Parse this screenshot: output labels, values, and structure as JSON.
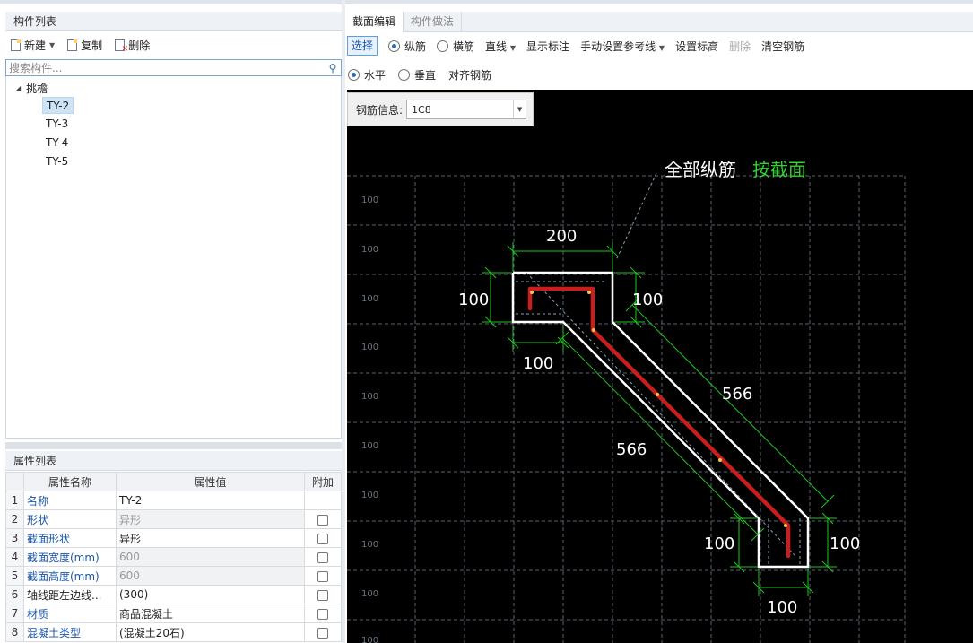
{
  "left_panel": {
    "title": "构件列表",
    "toolbar": {
      "new_label": "新建",
      "copy_label": "复制",
      "delete_label": "删除"
    },
    "search_placeholder": "搜索构件...",
    "tree": {
      "root_label": "挑檐",
      "items": [
        "TY-2",
        "TY-3",
        "TY-4",
        "TY-5"
      ],
      "selected": "TY-2"
    }
  },
  "properties": {
    "title": "属性列表",
    "headers": [
      "属性名称",
      "属性值",
      "附加"
    ],
    "rows": [
      {
        "idx": "1",
        "name": "名称",
        "value": "TY-2"
      },
      {
        "idx": "2",
        "name": "形状",
        "value": "异形"
      },
      {
        "idx": "3",
        "name": "截面形状",
        "value": "异形"
      },
      {
        "idx": "4",
        "name": "截面宽度(mm)",
        "value": "600"
      },
      {
        "idx": "5",
        "name": "截面高度(mm)",
        "value": "600"
      },
      {
        "idx": "6",
        "name": "轴线距左边线...",
        "value": "(300)"
      },
      {
        "idx": "7",
        "name": "材质",
        "value": "商品混凝土"
      },
      {
        "idx": "8",
        "name": "混凝土类型",
        "value": "(混凝土20石)"
      }
    ]
  },
  "editor": {
    "tabs": [
      "截面编辑",
      "构件做法"
    ],
    "toolbar1": {
      "select": "选择",
      "longitudinal": "纵筋",
      "transverse": "横筋",
      "line": "直线",
      "show_dims": "显示标注",
      "manual_ref": "手动设置参考线",
      "set_elevation": "设置标高",
      "delete": "删除",
      "clear_rebar": "清空钢筋"
    },
    "toolbar2": {
      "horizontal": "水平",
      "vertical": "垂直",
      "align_rebar": "对齐钢筋"
    },
    "rebar_info": {
      "label": "钢筋信息:",
      "value": "1C8"
    },
    "canvas": {
      "annotation_white": "全部纵筋",
      "annotation_green": "按截面",
      "grid_label": "100",
      "dims": {
        "top_width": "200",
        "left_height": "100",
        "right_height": "100",
        "bottom_left": "100",
        "diag_upper": "566",
        "diag_lower": "566",
        "end_left": "100",
        "end_right": "100",
        "end_bottom": "100"
      }
    },
    "colors": {
      "rebar": "#c81e1e",
      "dimension": "#22c322",
      "outline": "#ffffff",
      "grid": "#5a6470"
    }
  }
}
